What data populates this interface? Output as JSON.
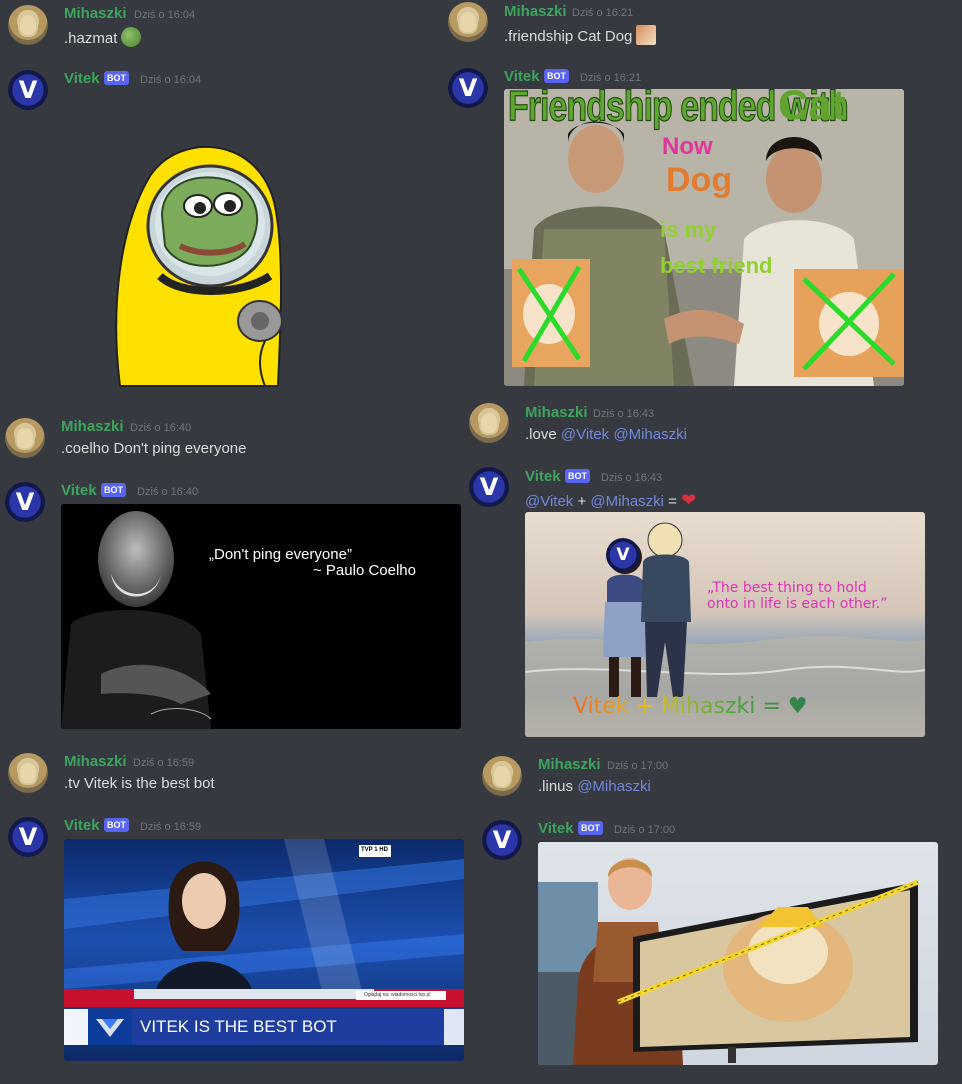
{
  "users": {
    "user": "Mihaszki",
    "bot": "Vitek",
    "bot_tag": "BOT",
    "bot_initial": "V"
  },
  "messages": [
    {
      "author": "Mihaszki",
      "time": "Dziś o 16:04",
      "text": ".hazmat"
    },
    {
      "author": "Vitek",
      "time": "Dziś o 16:04"
    },
    {
      "author": "Mihaszki",
      "time": "Dziś o 16:21",
      "text": ".friendship Cat Dog"
    },
    {
      "author": "Vitek",
      "time": "Dziś o 16:21"
    },
    {
      "author": "Mihaszki",
      "time": "Dziś o 16:40",
      "text": ".coelho Don't ping everyone"
    },
    {
      "author": "Vitek",
      "time": "Dziś o 16:40"
    },
    {
      "author": "Mihaszki",
      "time": "Dziś o 16:43",
      "text_prefix": ".love",
      "mentions": [
        "@Vitek",
        "@Mihaszki"
      ]
    },
    {
      "author": "Vitek",
      "time": "Dziś o 16:43",
      "text_mid": "+",
      "text_eq": "="
    },
    {
      "author": "Mihaszki",
      "time": "Dziś o 16:59",
      "text": ".tv Vitek is the best bot"
    },
    {
      "author": "Vitek",
      "time": "Dziś o 16:59"
    },
    {
      "author": "Mihaszki",
      "time": "Dziś o 17:00",
      "text_prefix": ".linus",
      "mentions": [
        "@Mihaszki"
      ]
    },
    {
      "author": "Vitek",
      "time": "Dziś o 17:00"
    }
  ],
  "images": {
    "friendship": {
      "line1": "Friendship ended with",
      "cat": "Cat",
      "now": "Now",
      "dog": "Dog",
      "is_my": "is my",
      "best_friend": "best friend"
    },
    "coelho": {
      "quote": "„Don't ping everyone”",
      "attribution": "~ Paulo Coelho"
    },
    "love": {
      "quote_line1": "„The best thing to hold",
      "quote_line2": "onto in life is each other.”",
      "bottom": "Vitek + Mihaszki = ♥",
      "bubble": "V"
    },
    "tv": {
      "headline": "VITEK IS THE BEST BOT",
      "ticker": "Oglądaj na: wiadomosci.tvp.pl",
      "channel": "TVP 1 HD"
    }
  },
  "colors": {
    "background": "#36393f",
    "name": "#3ba55c",
    "mention": "#7289da",
    "bot_tag": "#5865f2",
    "text": "#dcddde",
    "timestamp": "#72767d"
  }
}
